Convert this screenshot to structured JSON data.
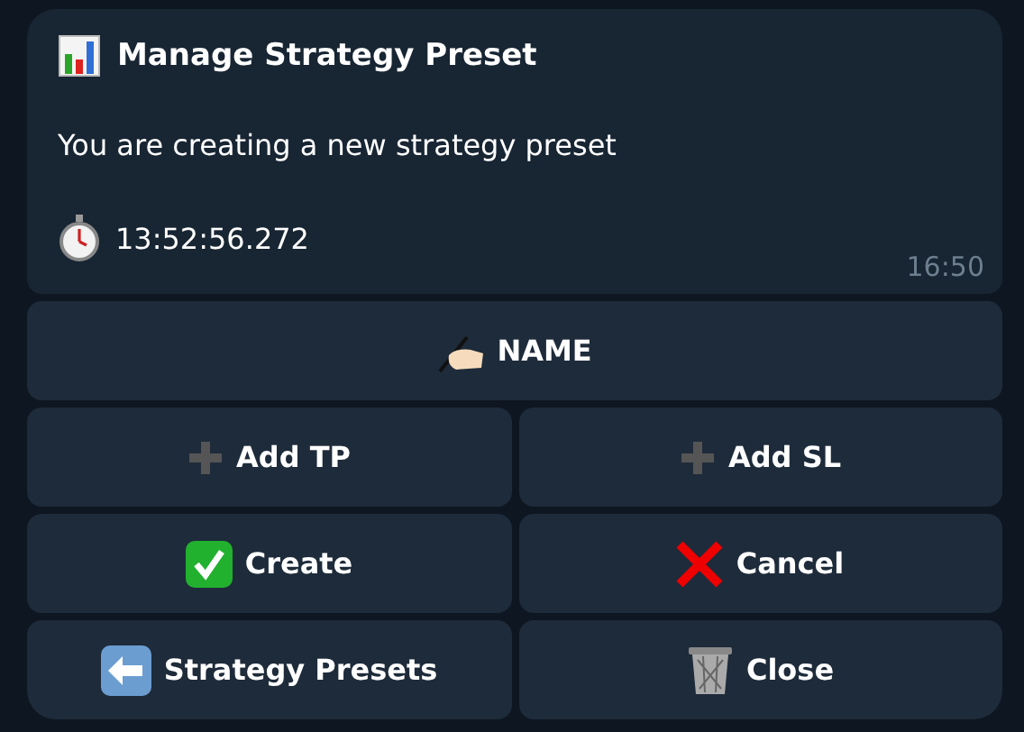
{
  "message": {
    "title": "Manage Strategy Preset",
    "text": "You are creating a new strategy preset",
    "timer": "13:52:56.272",
    "time": "16:50"
  },
  "keyboard": [
    [
      {
        "label": "NAME"
      }
    ],
    [
      {
        "label": "Add TP"
      },
      {
        "label": "Add SL"
      }
    ],
    [
      {
        "label": "Create"
      },
      {
        "label": "Cancel"
      }
    ],
    [
      {
        "label": "Strategy Presets"
      },
      {
        "label": "Close"
      }
    ]
  ]
}
